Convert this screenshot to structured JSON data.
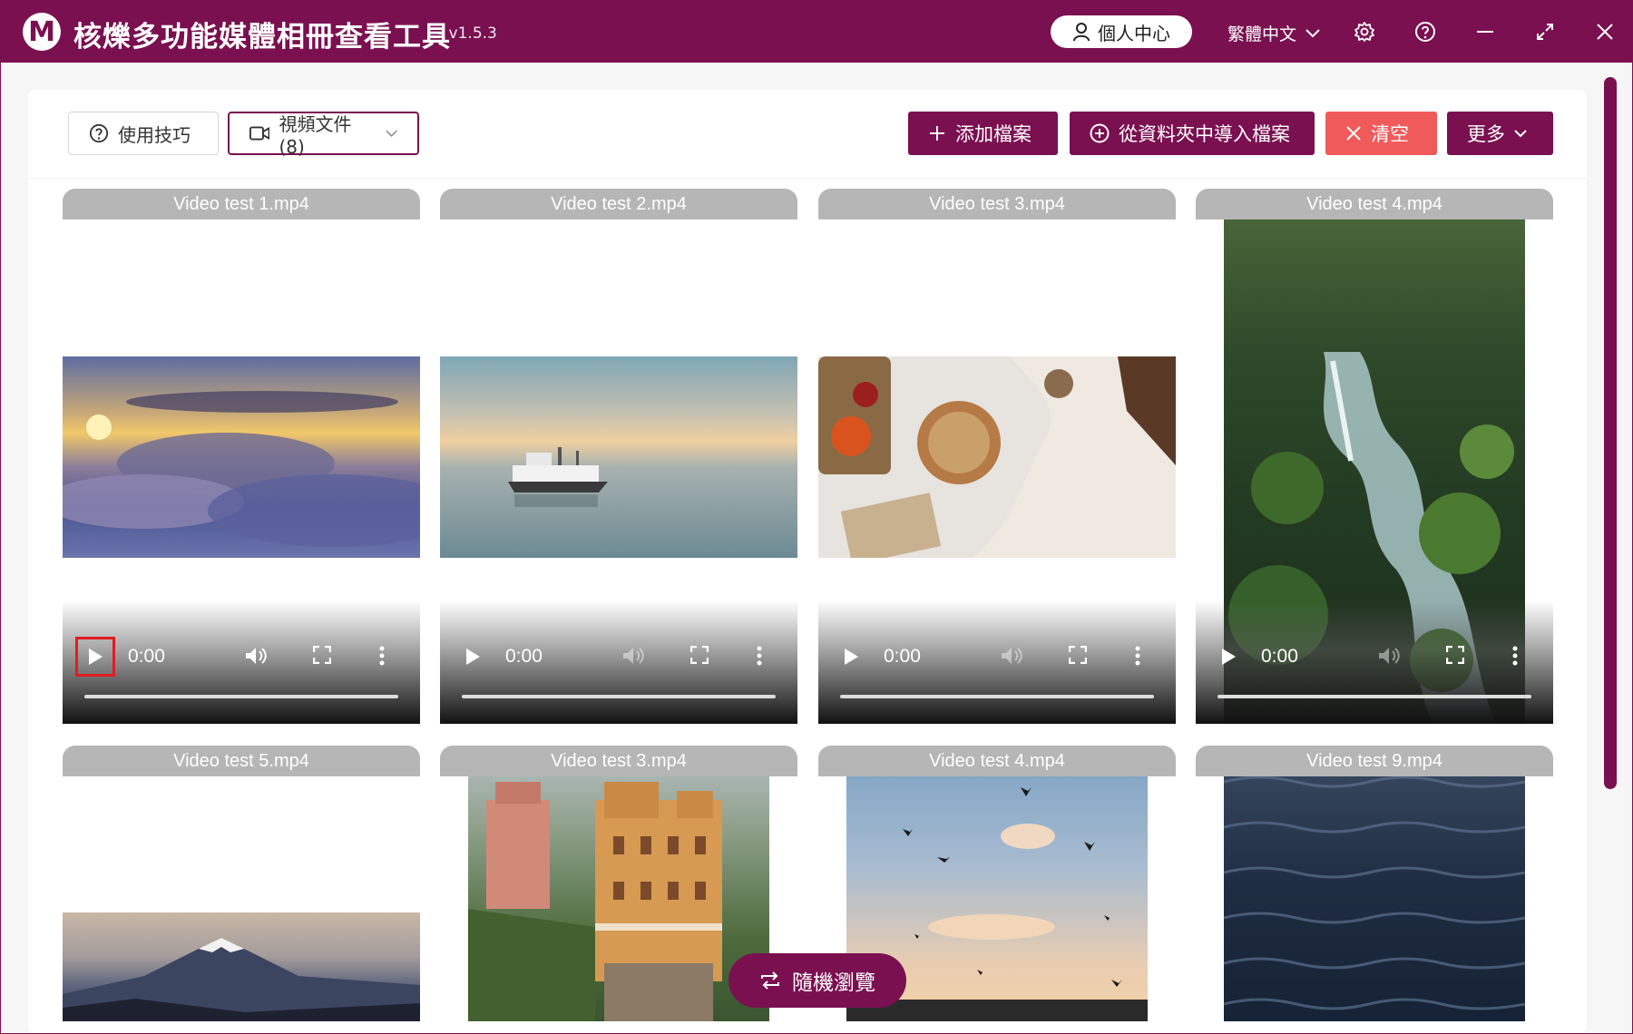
{
  "titlebar": {
    "logo": "M",
    "title": "核爍多功能媒體相冊查看工具",
    "version": "- v1.5.3",
    "user_center": "個人中心",
    "language": "繁體中文",
    "icons": [
      "user-icon",
      "chevron-down-icon",
      "gear-icon",
      "help-icon",
      "minimize-icon",
      "maximize-icon",
      "close-icon"
    ]
  },
  "toolbar": {
    "tips": "使用技巧",
    "filter": "視頻文件 (8)",
    "add_files": "添加檔案",
    "import_folder": "從資料夾中導入檔案",
    "clear": "清空",
    "more": "更多"
  },
  "colors": {
    "accent": "#7a1050",
    "danger": "#f15a5a",
    "name_bar": "#b6b6b6"
  },
  "videos": [
    {
      "name": "Video test 1.mp4",
      "time": "0:00",
      "thumb": "sunset-clouds"
    },
    {
      "name": "Video test 2.mp4",
      "time": "0:00",
      "thumb": "ship-at-sea"
    },
    {
      "name": "Video test 3.mp4",
      "time": "0:00",
      "thumb": "food-table"
    },
    {
      "name": "Video test 4.mp4",
      "time": "0:00",
      "thumb": "forest-waterfall"
    },
    {
      "name": "Video test 5.mp4",
      "thumb": "mount-fuji"
    },
    {
      "name": "Video test 3.mp4",
      "thumb": "cliff-building"
    },
    {
      "name": "Video test 4.mp4",
      "thumb": "birds-sky"
    },
    {
      "name": "Video test 9.mp4",
      "thumb": "ocean-waves"
    }
  ],
  "random_browse": "隨機瀏覽"
}
